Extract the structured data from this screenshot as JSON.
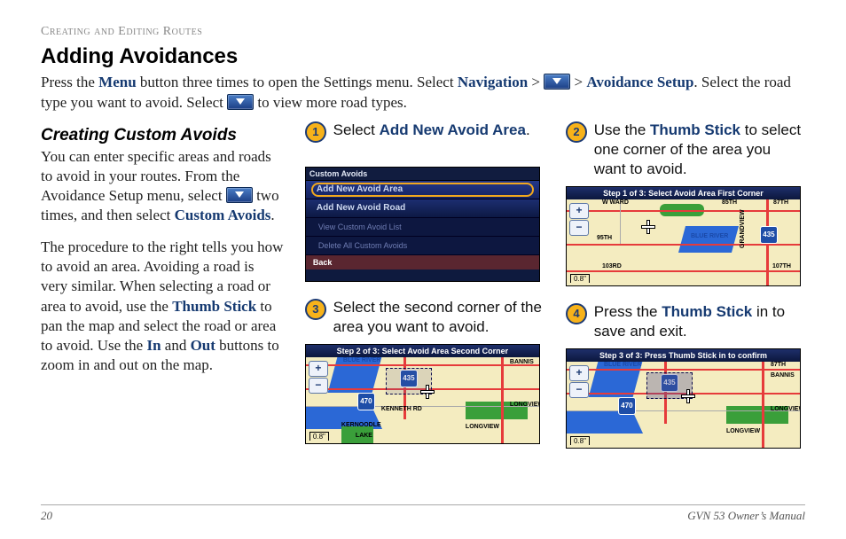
{
  "section_header": "Creating and Editing Routes",
  "heading": "Adding Avoidances",
  "intro": {
    "t1": "Press the ",
    "menu": "Menu",
    "t2": " button three times to open the Settings menu. Select ",
    "navigation": "Navigation",
    "gt1": " > ",
    "gt2": " > ",
    "avoidance_setup": "Avoidance Setup",
    "t3": ". Select the road type you want to avoid. Select ",
    "t4": " to view more road types."
  },
  "left": {
    "subheading": "Creating Custom Avoids",
    "p1a": "You can enter specific areas and roads to avoid in your routes. From the Avoidance Setup menu, select ",
    "p1b": " two times, and then select ",
    "custom_avoids": "Custom Avoids",
    "p1c": ".",
    "p2a": "The procedure to the right tells you how to avoid an area. Avoiding a road is very similar. When selecting a road or area to avoid, use the ",
    "thumb_stick": "Thumb Stick",
    "p2b": " to pan the map and select the road or area to avoid. Use the ",
    "in": "In",
    "and": " and ",
    "out": "Out",
    "p2c": " buttons to zoom in and out on the map."
  },
  "steps": {
    "s1": {
      "num": "1",
      "a": "Select ",
      "b": "Add New Avoid Area",
      "c": "."
    },
    "s2": {
      "num": "2",
      "a": "Use the ",
      "b": "Thumb Stick",
      "c": " to select one corner of the area you want to avoid."
    },
    "s3": {
      "num": "3",
      "a": "Select the second corner of the area you want to avoid."
    },
    "s4": {
      "num": "4",
      "a": "Press the ",
      "b": "Thumb Stick",
      "c": " in to save and exit."
    }
  },
  "menu": {
    "tab": "Custom Avoids",
    "items": [
      "Add New Avoid Area",
      "Add New Avoid Road",
      "View Custom Avoid List",
      "Delete All Custom Avoids"
    ],
    "back": "Back"
  },
  "map": {
    "t1": "Step 1 of 3: Select Avoid Area First Corner",
    "t2": "Step 2 of 3: Select Avoid Area Second Corner",
    "t3": "Step 3 of 3: Press Thumb Stick in to confirm",
    "shield_435": "435",
    "shield_470": "470",
    "scale": "0.8\"",
    "labels": {
      "blue_river": "BLUE RIVER",
      "ward": "W WARD",
      "85th": "85TH",
      "87th": "87TH",
      "95th": "95TH",
      "103rd": "103RD",
      "107th": "107TH",
      "bannis": "BANNIS",
      "longview": "LONGVIEW",
      "grandview": "GRANDVIEW",
      "kenneth": "KENNETH RD",
      "kernoodle": "KERNOODLE",
      "lake": "LAKE"
    }
  },
  "footer": {
    "page": "20",
    "manual": "GVN 53 Owner’s Manual"
  }
}
